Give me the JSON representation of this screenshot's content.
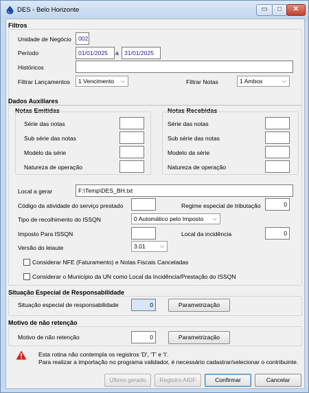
{
  "window": {
    "title": "DES - Belo Horizonte",
    "min": "▭",
    "max": "□",
    "close": "✕"
  },
  "filtros": {
    "title": "Filtros",
    "unidade_label": "Unidade de Negócio",
    "unidade_value": "002",
    "periodo_label": "Período",
    "periodo_start": "01/01/2025",
    "periodo_sep": "a",
    "periodo_end": "31/01/2025",
    "historicos_label": "Históricos",
    "historicos_value": "",
    "lancamentos_label": "Filtrar Lançamentos",
    "lancamentos_value": "1 Vencimento",
    "notas_label": "Filtrar Notas",
    "notas_value": "1 Ambos"
  },
  "dados": {
    "title": "Dados Auxiliares",
    "emitidas": {
      "title": "Notas Emitidas",
      "serie": "Série das notas",
      "subserie": "Sub série das notas",
      "modelo": "Modelo da série",
      "natureza": "Natureza de operação"
    },
    "recebidas": {
      "title": "Notas Recebidas",
      "serie": "Série das notas",
      "subserie": "Sub série das notas",
      "modelo": "Modelo da série",
      "natureza": "Natureza de operação"
    },
    "local_label": "Local a gerar",
    "local_value": "F:\\Temp\\DES_BH.txt",
    "codigo_label": "Código da atividade do serviço prestado",
    "regime_label": "Regime especial de tributação",
    "regime_value": "0",
    "tipo_label": "Tipo de recolhimento do ISSQN",
    "tipo_value": "0 Automático pelo Imposto",
    "imposto_label": "Imposto Para ISSQN",
    "local_incid_label": "Local da incidência",
    "local_incid_value": "0",
    "versao_label": "Versão do leiaute",
    "versao_value": "3.01",
    "chk1_label": "Considerar NFE (Faturamento) e Notas Fiscais Canceladas",
    "chk2_label": "Considerar o Município da UN como Local da Incidência/Prestação do ISSQN"
  },
  "situacao": {
    "title": "Situação Especial de Responsabilidade",
    "label": "Situação especial de responsabilidade",
    "value": "0",
    "button": "Parametrização"
  },
  "motivo": {
    "title": "Motivo de não retenção",
    "label": "Motivo de não retenção",
    "value": "0",
    "button": "Parametrização"
  },
  "warning": {
    "line1": "Esta rotina não contempla os registros 'D', 'T' e 'I'.",
    "line2": "Para realizar a importação no programa validador, é necessário cadastrar/selecionar o contribuinte."
  },
  "footer": {
    "ultimo": "Último gerado",
    "registro": "Registro AIDF",
    "confirmar": "Confirmar",
    "cancelar": "Cancelar"
  },
  "colors": {
    "accent": "#1a1a9a",
    "warning": "#d9211b",
    "titlebar": "#c6d9ef"
  }
}
